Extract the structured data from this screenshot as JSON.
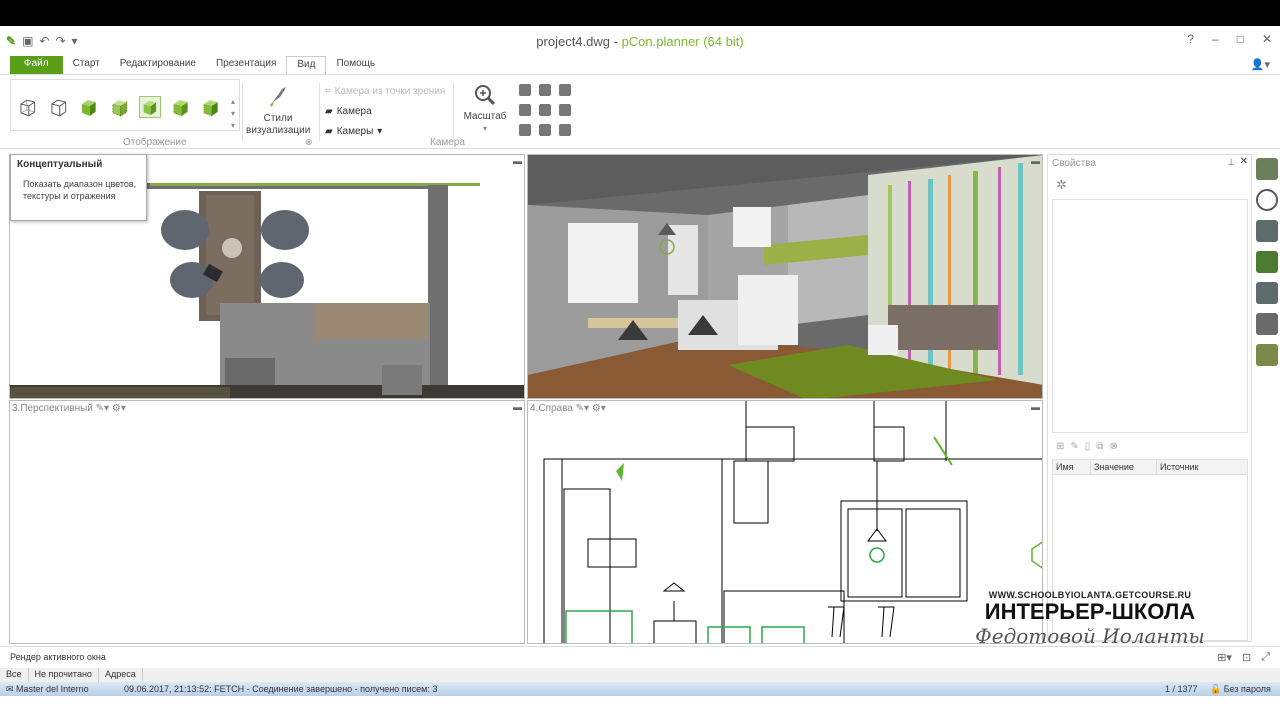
{
  "window": {
    "file_name": "project4.dwg",
    "separator": " - ",
    "app_name": "pCon.planner (64 bit)",
    "controls": [
      "?",
      "–",
      "□",
      "✕"
    ]
  },
  "tabs": [
    "Файл",
    "Старт",
    "Редактирование",
    "Презентация",
    "Вид",
    "Помощь"
  ],
  "active_tab": "Вид",
  "ribbon": {
    "display_group_label": "Отображение",
    "styles_label": "Стили\nвизуализации",
    "camera_from_viewpoint": "Камера из точки зрения",
    "camera": "Камера",
    "cameras": "Камеры",
    "camera_group_label": "Камера",
    "zoom_label": "Масштаб",
    "display_modes": [
      "wireframe-icon",
      "hidden-line-icon",
      "shaded-icon",
      "textured-icon",
      "conceptual-icon",
      "realistic-icon",
      "shadows-icon"
    ],
    "selected_mode": "conceptual-icon"
  },
  "tooltip": {
    "title": "Концептуальный",
    "body": "Показать диапазон цветов, текстуры и отражения"
  },
  "viewports": {
    "vp1_label": "",
    "vp2_label": "",
    "vp3_label": "3.Перспективный",
    "vp4_label": "4.Справа"
  },
  "properties": {
    "title": "Свойства",
    "columns": [
      "Имя",
      "Значение",
      "Источник"
    ]
  },
  "status": {
    "text": "Рендер активного окна"
  },
  "bottom_tabs": [
    "Все",
    "Не прочитано",
    "Адреса"
  ],
  "taskbar": {
    "app": "Master del Interno",
    "message": "09.06.2017, 21:13:52: FETCH - Соединение завершено - получено писем: 3",
    "count": "1 / 1377",
    "right": "Без пароля"
  },
  "watermark": {
    "url": "WWW.SCHOOLBYIOLANTA.GETCOURSE.RU",
    "main": "ИНТЕРЬЕР-ШКОЛА",
    "signature": "Федотовой Иоланты"
  },
  "colors": {
    "accent": "#5a9e1a",
    "app_name": "#7cb82f",
    "side_icon": "#5d6b6b"
  }
}
